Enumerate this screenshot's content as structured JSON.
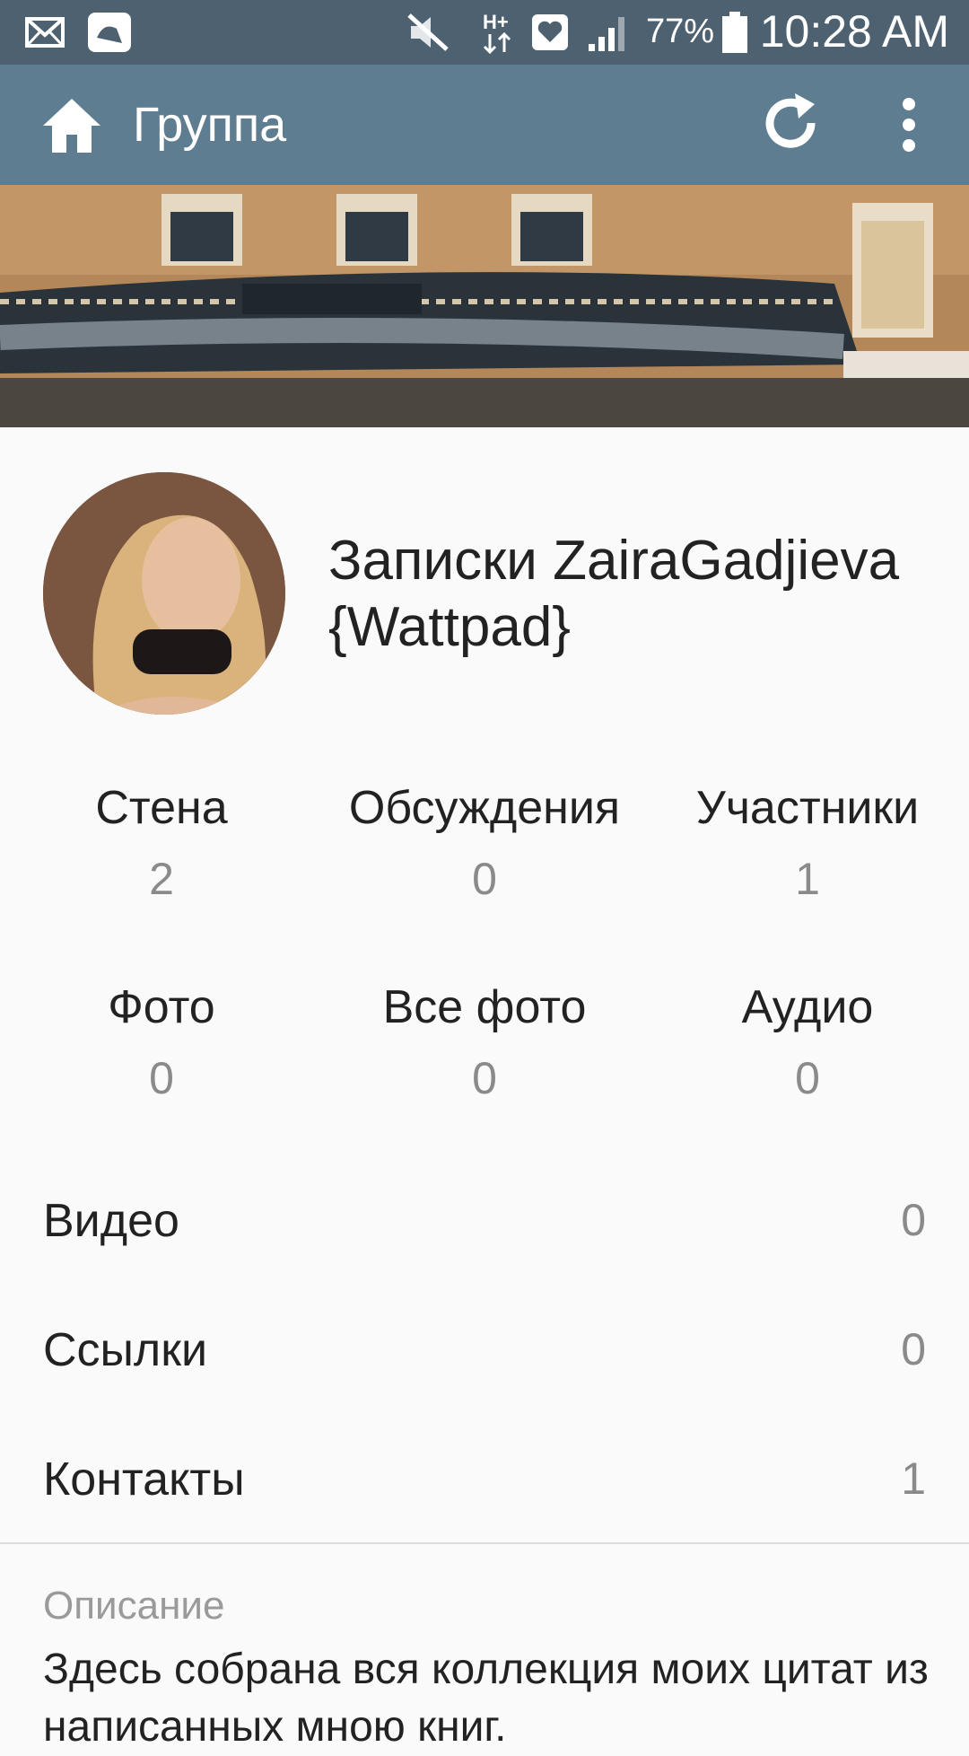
{
  "status_bar": {
    "battery_percent": "77%",
    "time": "10:28 AM",
    "icons": [
      "mail-icon",
      "gallery-icon",
      "mute-icon",
      "network-h-plus-icon",
      "heart-icon",
      "signal-icon",
      "battery-icon"
    ]
  },
  "app_bar": {
    "title": "Группа",
    "icons": [
      "home-icon",
      "refresh-icon",
      "more-vert-icon"
    ]
  },
  "group": {
    "name": "Записки ZairaGadjieva {Wattpad}"
  },
  "stats": [
    {
      "label": "Стена",
      "count": "2"
    },
    {
      "label": "Обсуждения",
      "count": "0"
    },
    {
      "label": "Участники",
      "count": "1"
    },
    {
      "label": "Фото",
      "count": "0"
    },
    {
      "label": "Все фото",
      "count": "0"
    },
    {
      "label": "Аудио",
      "count": "0"
    }
  ],
  "rows": [
    {
      "label": "Видео",
      "count": "0"
    },
    {
      "label": "Ссылки",
      "count": "0"
    },
    {
      "label": "Контакты",
      "count": "1"
    }
  ],
  "description": {
    "label": "Описание",
    "text": "Здесь собрана вся коллекция моих цитат из написанных мною книг."
  },
  "colors": {
    "status_bar": "#4e6170",
    "app_bar": "#5f7d91",
    "text": "#222222",
    "muted": "#8a8a8a"
  }
}
